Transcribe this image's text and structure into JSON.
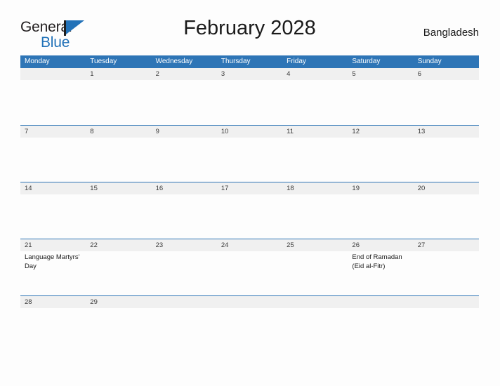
{
  "brand": {
    "name_line1": "General",
    "name_line2": "Blue",
    "logo_icon": "flag-triangle-icon",
    "accent_color": "#2272B8"
  },
  "header": {
    "title": "February 2028",
    "country": "Bangladesh"
  },
  "theme": {
    "header_blue": "#2E75B6",
    "band_gray": "#F0F0F0",
    "text_dark": "#1A1A1A"
  },
  "calendar": {
    "weekdays": [
      "Monday",
      "Tuesday",
      "Wednesday",
      "Thursday",
      "Friday",
      "Saturday",
      "Sunday"
    ],
    "weeks": [
      {
        "days": [
          {
            "num": "",
            "event": ""
          },
          {
            "num": "1",
            "event": ""
          },
          {
            "num": "2",
            "event": ""
          },
          {
            "num": "3",
            "event": ""
          },
          {
            "num": "4",
            "event": ""
          },
          {
            "num": "5",
            "event": ""
          },
          {
            "num": "6",
            "event": ""
          }
        ]
      },
      {
        "days": [
          {
            "num": "7",
            "event": ""
          },
          {
            "num": "8",
            "event": ""
          },
          {
            "num": "9",
            "event": ""
          },
          {
            "num": "10",
            "event": ""
          },
          {
            "num": "11",
            "event": ""
          },
          {
            "num": "12",
            "event": ""
          },
          {
            "num": "13",
            "event": ""
          }
        ]
      },
      {
        "days": [
          {
            "num": "14",
            "event": ""
          },
          {
            "num": "15",
            "event": ""
          },
          {
            "num": "16",
            "event": ""
          },
          {
            "num": "17",
            "event": ""
          },
          {
            "num": "18",
            "event": ""
          },
          {
            "num": "19",
            "event": ""
          },
          {
            "num": "20",
            "event": ""
          }
        ]
      },
      {
        "days": [
          {
            "num": "21",
            "event": "Language Martyrs' Day"
          },
          {
            "num": "22",
            "event": ""
          },
          {
            "num": "23",
            "event": ""
          },
          {
            "num": "24",
            "event": ""
          },
          {
            "num": "25",
            "event": ""
          },
          {
            "num": "26",
            "event": "End of Ramadan (Eid al-Fitr)"
          },
          {
            "num": "27",
            "event": ""
          }
        ]
      },
      {
        "days": [
          {
            "num": "28",
            "event": ""
          },
          {
            "num": "29",
            "event": ""
          },
          {
            "num": "",
            "event": ""
          },
          {
            "num": "",
            "event": ""
          },
          {
            "num": "",
            "event": ""
          },
          {
            "num": "",
            "event": ""
          },
          {
            "num": "",
            "event": ""
          }
        ]
      }
    ]
  }
}
